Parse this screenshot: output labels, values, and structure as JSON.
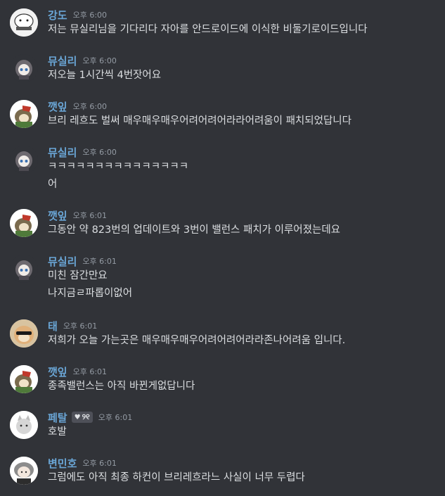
{
  "messages": [
    {
      "author": "강도",
      "time": "오후 6:00",
      "lines": [
        "저는 뮤실리님을 기다리다 자아를 안드로이드에 이식한 비둘기로이드입니다"
      ]
    },
    {
      "author": "뮤실리",
      "time": "오후 6:00",
      "lines": [
        "저오늘 1시간씩 4번잣어요"
      ]
    },
    {
      "author": "깻잎",
      "time": "오후 6:00",
      "lines": [
        "브리 레흐도 벌써 매우매우매우어려어려어라라어려움이 패치되었답니다"
      ]
    },
    {
      "author": "뮤실리",
      "time": "오후 6:00",
      "lines": [
        "ㅋㅋㅋㅋㅋㅋㅋㅋㅋㅋㅋㅋㅋㅋㅋ",
        "어"
      ]
    },
    {
      "author": "깻잎",
      "time": "오후 6:01",
      "lines": [
        "그동안 약 823번의 업데이트와 3번이 밸런스 패치가 이루어졌는데요"
      ]
    },
    {
      "author": "뮤실리",
      "time": "오후 6:01",
      "lines": [
        "미친 잠간만요",
        "나지금ㄹ파롭이없어"
      ]
    },
    {
      "author": "태",
      "time": "오후 6:01",
      "lines": [
        "저희가 오늘 가는곳은 매우매우매우어려어려어라라존나어려움 입니다."
      ]
    },
    {
      "author": "깻잎",
      "time": "오후 6:01",
      "lines": [
        "종족밸런스는 아직 바뀐게없답니다"
      ]
    },
    {
      "author": "페탈",
      "badge": "୨୧",
      "time": "오후 6:01",
      "lines": [
        "호발"
      ]
    },
    {
      "author": "변민호",
      "time": "오후 6:01",
      "lines": [
        "그럼에도 아직 최종 하컨이 브리레흐라느 사실이 너무 두렵다"
      ]
    }
  ],
  "colors": {
    "background": "#313338",
    "username": "#6aa6d6",
    "text": "#dbdee1",
    "timestamp": "#949ba4"
  }
}
